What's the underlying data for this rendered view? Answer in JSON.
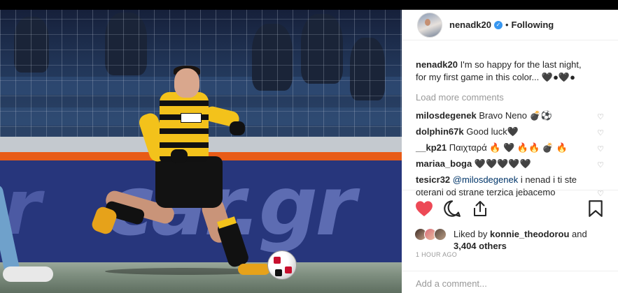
{
  "post": {
    "username": "nenadk20",
    "verified_glyph": "✓",
    "separator": "•",
    "follow_status": "Following",
    "caption_user": "nenadk20",
    "caption_text": "I'm so happy for the last night, for my first game in this color... 🖤●🖤●",
    "load_more": "Load more comments",
    "comments": [
      {
        "user": "milosdegenek",
        "text": "Bravo Neno 💣⚽"
      },
      {
        "user": "dolphin67k",
        "text": "Good luck🖤"
      },
      {
        "user": "__kp21",
        "text": "Παιχταρά 🔥 🖤 🔥🔥 💣 🔥"
      },
      {
        "user": "mariaa_boga",
        "text": "🖤🖤🖤🖤🖤"
      },
      {
        "user": "tesicr32",
        "mention": "@milosdegenek",
        "text": " i nenad i ti ste oterani od strane terzica jebacemo"
      }
    ],
    "comment_like_icon": "heart-outline-icon",
    "liked_by_prefix": "Liked by ",
    "liked_by_user": "konnie_theodorou",
    "liked_by_and": " and",
    "likes_count": "3,404 others",
    "timestamp": "1 HOUR AGO",
    "add_comment_placeholder": "Add a comment...",
    "like_color": "#ed4956"
  },
  "photo": {
    "board_text": "car.gr",
    "board_text_left": "r"
  }
}
